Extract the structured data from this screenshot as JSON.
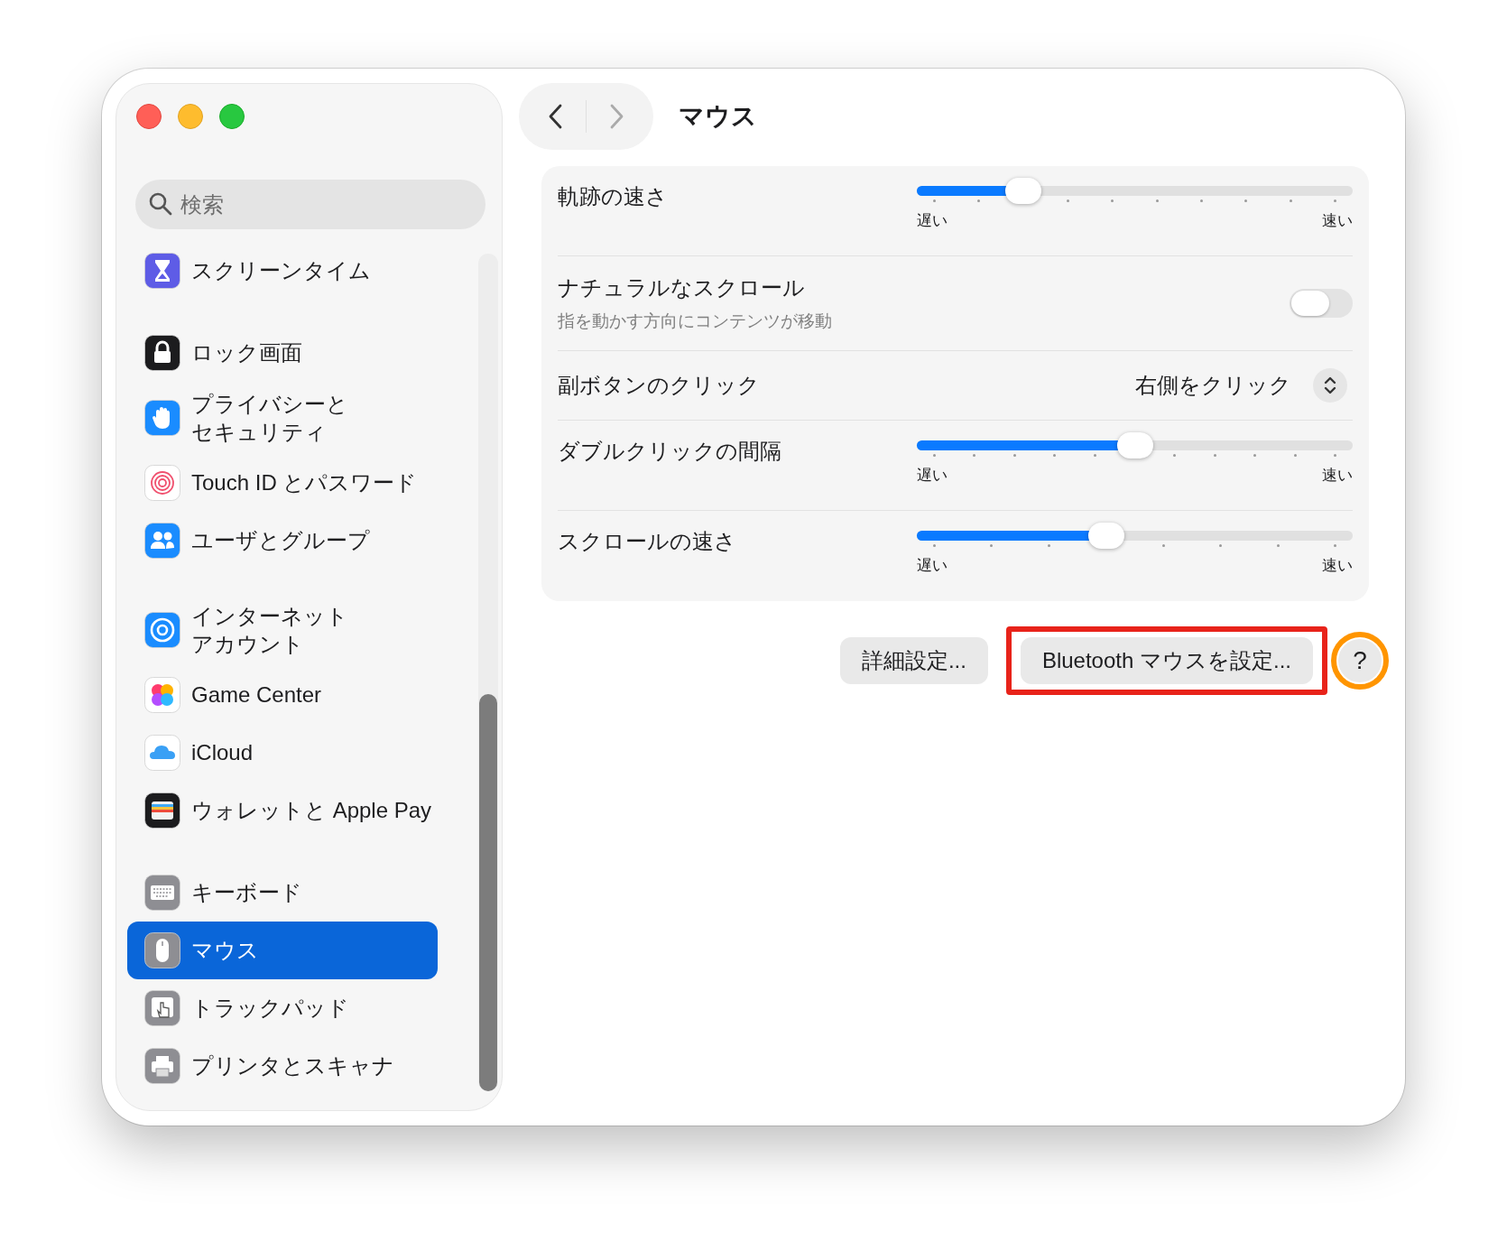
{
  "window": {
    "title": "マウス"
  },
  "sidebar": {
    "search": {
      "placeholder": "検索"
    },
    "groups": [
      {
        "items": [
          {
            "label": "スクリーンタイム",
            "selected": false
          }
        ]
      },
      {
        "items": [
          {
            "label": "ロック画面",
            "selected": false
          },
          {
            "lines": [
              "プライバシーと",
              "セキュリティ"
            ],
            "selected": false
          },
          {
            "label": "Touch ID とパスワード",
            "selected": false
          },
          {
            "label": "ユーザとグループ",
            "selected": false
          }
        ]
      },
      {
        "items": [
          {
            "lines": [
              "インターネット",
              "アカウント"
            ],
            "selected": false
          },
          {
            "label": "Game Center",
            "selected": false
          },
          {
            "label": "iCloud",
            "selected": false
          },
          {
            "label": "ウォレットと Apple Pay",
            "selected": false
          }
        ]
      },
      {
        "items": [
          {
            "label": "キーボード",
            "selected": false
          },
          {
            "label": "マウス",
            "selected": true
          },
          {
            "label": "トラックパッド",
            "selected": false
          },
          {
            "label": "プリンタとスキャナ",
            "selected": false
          }
        ]
      }
    ]
  },
  "settings": [
    {
      "kind": "slider",
      "label": "軌跡の速さ",
      "level": 0.245,
      "min_label": "遅い",
      "max_label": "速い"
    },
    {
      "kind": "toggle",
      "label": "ナチュラルなスクロール",
      "description": "指を動かす方向にコンテンツが移動",
      "on": false
    },
    {
      "kind": "popup",
      "label": "副ボタンのクリック",
      "value": "右側をクリック"
    },
    {
      "kind": "slider",
      "label": "ダブルクリックの間隔",
      "level": 0.5,
      "min_label": "遅い",
      "max_label": "速い"
    },
    {
      "kind": "slider",
      "label": "スクロールの速さ",
      "level": 0.435,
      "min_label": "遅い",
      "max_label": "速い"
    }
  ],
  "buttons": [
    {
      "label": "詳細設定..."
    },
    {
      "label": "Bluetooth マウスを設定...",
      "highlighted": true
    },
    {
      "label": "?",
      "highlighted": true
    }
  ]
}
